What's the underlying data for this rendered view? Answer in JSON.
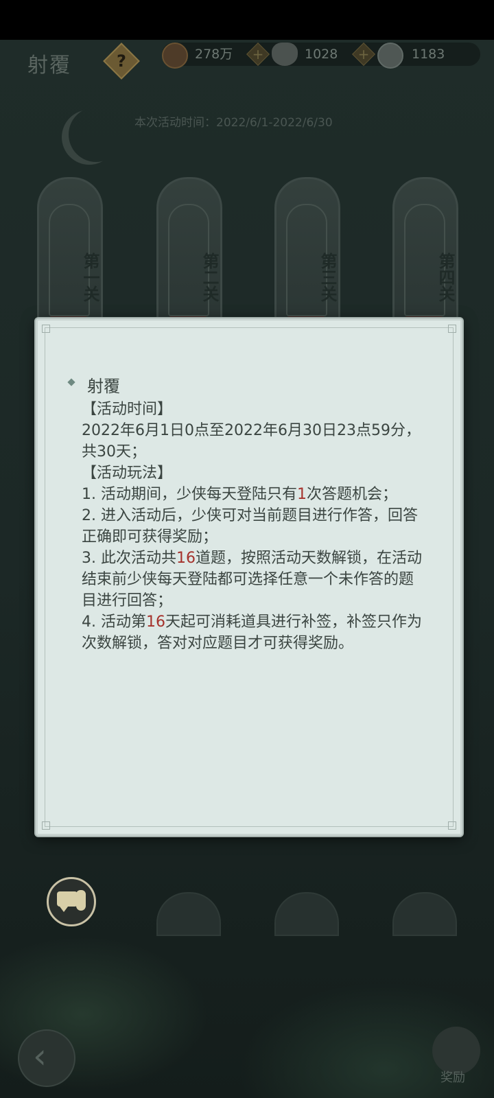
{
  "header": {
    "title": "射覆",
    "help_label": "?",
    "resources": [
      {
        "icon": "copper-coin-icon",
        "value": "278万"
      },
      {
        "icon": "silver-ingot-icon",
        "value": "1028"
      },
      {
        "icon": "jade-coin-icon",
        "value": "1183"
      }
    ],
    "activity_time": "本次活动时间：2022/6/1-2022/6/30"
  },
  "levels": [
    "第一关",
    "第二关",
    "第三关",
    "第四关"
  ],
  "modal": {
    "heading": "射覆",
    "section_time": "【活动时间】",
    "time_text": "2022年6月1日0点至2022年6月30日23点59分，共30天；",
    "section_rules": "【活动玩法】",
    "rule1_a": "1. 活动期间，少侠每天登陆只有",
    "rule1_hl": "1",
    "rule1_b": "次答题机会；",
    "rule2": "2. 进入活动后，少侠可对当前题目进行作答，回答正确即可获得奖励；",
    "rule3_a": "3. 此次活动共",
    "rule3_hl": "16",
    "rule3_b": "道题，按照活动天数解锁，在活动结束前少侠每天登陆都可选择任意一个未作答的题目进行回答；",
    "rule4_a": "4. 活动第",
    "rule4_hl": "16",
    "rule4_b": "天起可消耗道具进行补签，补签只作为次数解锁，答对对应题目才可获得奖励。"
  },
  "footer": {
    "reward_label": "奖励",
    "back_icon": "back-arrow-icon",
    "chat_icon": "chat-bubble-icon"
  },
  "colors": {
    "highlight": "#a5322c",
    "modal_bg": "#dde8e5"
  }
}
